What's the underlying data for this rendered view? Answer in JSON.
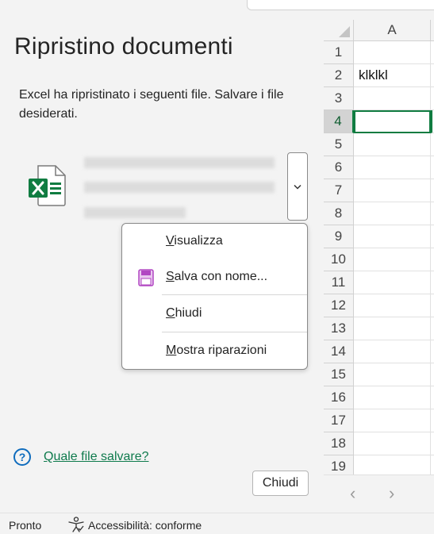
{
  "pane": {
    "title": "Ripristino documenti",
    "description": "Excel ha ripristinato i seguenti file. Salvare i file desiderati.",
    "help_link": "Quale file salvare?",
    "close_button": "Chiudi"
  },
  "dropdown_menu": {
    "items": [
      {
        "label": "Visualizza",
        "icon": "none"
      },
      {
        "label": "Salva con nome...",
        "icon": "save-as-icon"
      },
      {
        "label": "Chiudi",
        "icon": "none"
      },
      {
        "label": "Mostra riparazioni",
        "icon": "none"
      }
    ]
  },
  "grid": {
    "column_header": "A",
    "rows": [
      {
        "num": "1",
        "a": ""
      },
      {
        "num": "2",
        "a": "klklkl"
      },
      {
        "num": "3",
        "a": ""
      },
      {
        "num": "4",
        "a": ""
      },
      {
        "num": "5",
        "a": ""
      },
      {
        "num": "6",
        "a": ""
      },
      {
        "num": "7",
        "a": ""
      },
      {
        "num": "8",
        "a": ""
      },
      {
        "num": "9",
        "a": ""
      },
      {
        "num": "10",
        "a": ""
      },
      {
        "num": "11",
        "a": ""
      },
      {
        "num": "12",
        "a": ""
      },
      {
        "num": "13",
        "a": ""
      },
      {
        "num": "14",
        "a": ""
      },
      {
        "num": "15",
        "a": ""
      },
      {
        "num": "16",
        "a": ""
      },
      {
        "num": "17",
        "a": ""
      },
      {
        "num": "18",
        "a": ""
      },
      {
        "num": "19",
        "a": ""
      }
    ],
    "active_row": "4"
  },
  "nav": {
    "prev": "‹",
    "next": "›"
  },
  "status_bar": {
    "ready": "Pronto",
    "accessibility": "Accessibilità: conforme"
  },
  "colors": {
    "excel_green": "#107c41",
    "link_green": "#0e7a4c",
    "help_blue": "#0f6cbd",
    "save_purple": "#b146c2"
  }
}
